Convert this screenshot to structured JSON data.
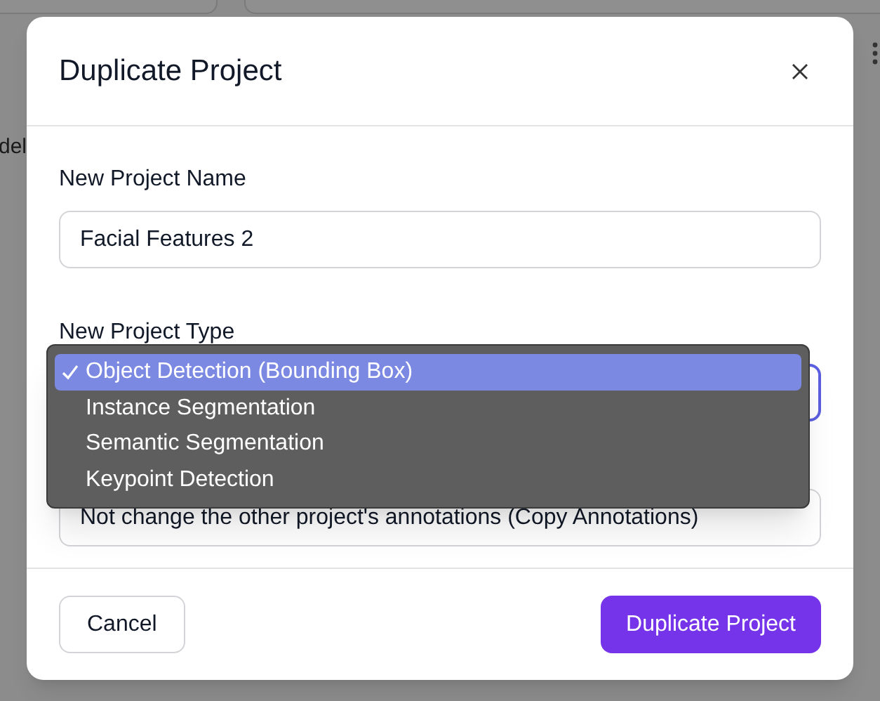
{
  "background": {
    "partial_text": "del"
  },
  "dialog": {
    "title": "Duplicate Project",
    "fields": [
      {
        "label": "New Project Name",
        "value": "Facial Features 2"
      },
      {
        "label": "New Project Type",
        "focused": true
      },
      {
        "value": "Not change the other project's annotations (Copy Annotations)"
      }
    ],
    "dropdown": {
      "options": [
        {
          "label": "Object Detection (Bounding Box)",
          "selected": true
        },
        {
          "label": "Instance Segmentation",
          "selected": false
        },
        {
          "label": "Semantic Segmentation",
          "selected": false
        },
        {
          "label": "Keypoint Detection",
          "selected": false
        }
      ]
    },
    "buttons": [
      {
        "kind": "secondary",
        "label": "Cancel"
      },
      {
        "kind": "primary",
        "label": "Duplicate Project"
      }
    ]
  }
}
